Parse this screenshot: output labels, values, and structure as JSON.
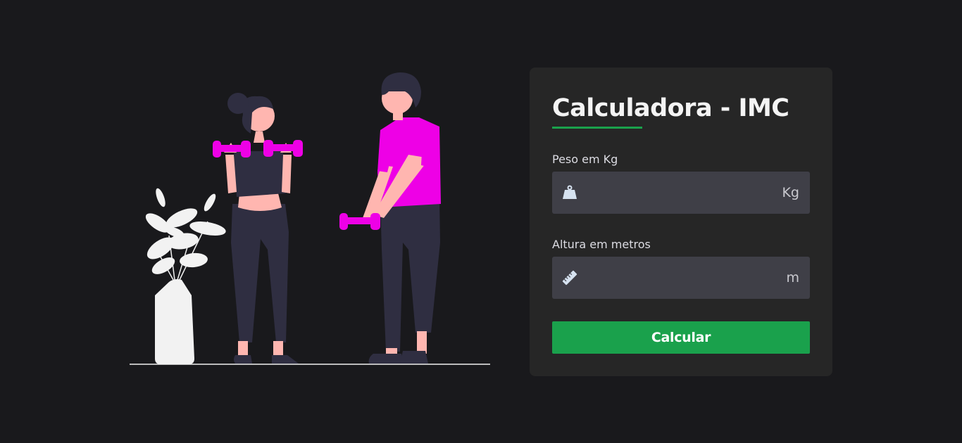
{
  "colors": {
    "background": "#19191c",
    "card": "#262626",
    "accent": "#1aa14c",
    "input_bg": "#3f3f47",
    "magenta": "#ee00e6",
    "pants": "#2f2e41",
    "skin": "#ffb6b0"
  },
  "card": {
    "title": "Calculadora - IMC",
    "weight": {
      "label": "Peso em Kg",
      "value": "",
      "placeholder": "",
      "unit": "Kg",
      "icon": "weight-icon"
    },
    "height": {
      "label": "Altura em metros",
      "value": "",
      "placeholder": "",
      "unit": "m",
      "icon": "ruler-icon"
    },
    "submit_label": "Calcular"
  },
  "illustration": {
    "icon": "fitness-illustration"
  }
}
